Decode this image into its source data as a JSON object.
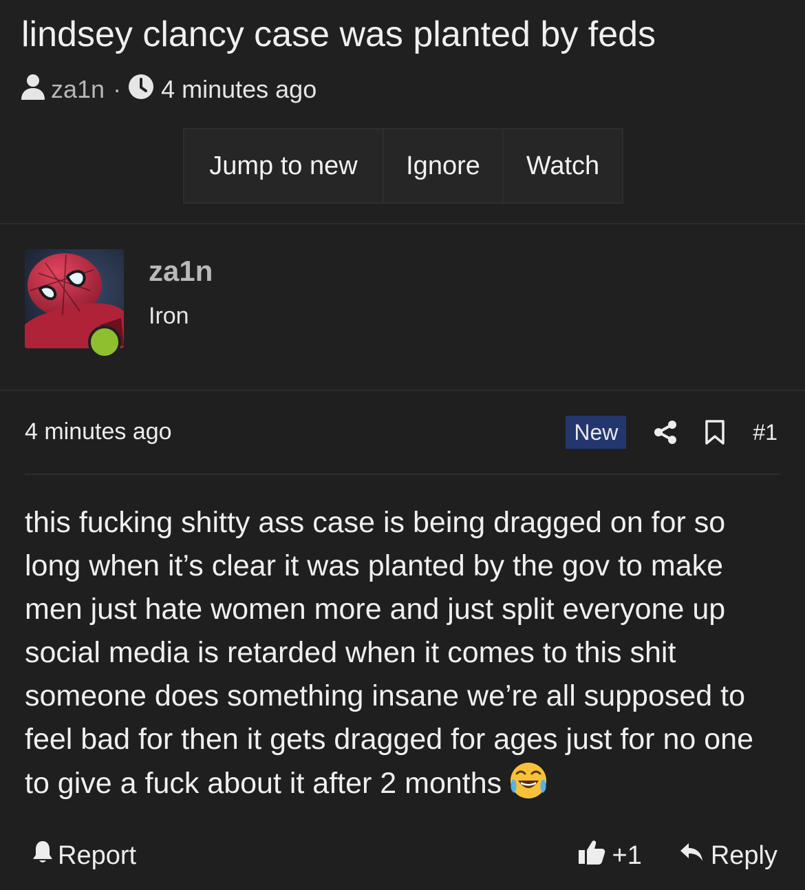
{
  "thread": {
    "title": "lindsey clancy case was planted by feds",
    "author": "za1n",
    "separator": "·",
    "time": "4 minutes ago",
    "buttons": {
      "jump": "Jump to new",
      "ignore": "Ignore",
      "watch": "Watch"
    }
  },
  "user": {
    "name": "za1n",
    "title": "Iron",
    "online": true,
    "status_color": "#8fbf2f"
  },
  "post": {
    "time": "4 minutes ago",
    "badge": "New",
    "number": "#1",
    "body": "this fucking shitty ass case is being dragged on for so long when it’s clear it was planted by the gov to make men just hate women more and just split everyone up social media is retarded when it comes to this shit someone does something insane we’re all supposed to feel bad for then it gets dragged for ages just for no one to give a fuck about it after 2 months",
    "emoji": "face-with-tears-of-joy",
    "footer": {
      "report": "Report",
      "like_count": "+1",
      "reply": "Reply"
    }
  },
  "icons": [
    "user-icon",
    "clock-icon",
    "share-icon",
    "bookmark-icon",
    "bell-icon",
    "thumbs-up-icon",
    "reply-arrow-icon"
  ],
  "colors": {
    "background": "#1f1f1f",
    "badge": "#24366e",
    "online": "#8fbf2f"
  }
}
